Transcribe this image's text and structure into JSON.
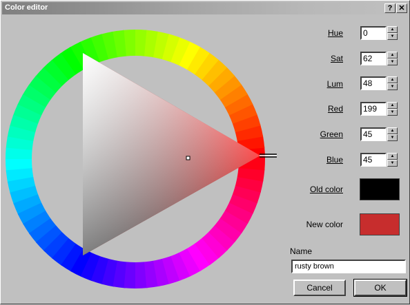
{
  "window": {
    "title": "Color editor",
    "help_glyph": "?",
    "close_glyph": "✕"
  },
  "fields": [
    {
      "key": "hue",
      "label": "Hue",
      "value": "0"
    },
    {
      "key": "sat",
      "label": "Sat",
      "value": "62"
    },
    {
      "key": "lum",
      "label": "Lum",
      "value": "48"
    },
    {
      "key": "red",
      "label": "Red",
      "value": "199"
    },
    {
      "key": "green",
      "label": "Green",
      "value": "45"
    },
    {
      "key": "blue",
      "label": "Blue",
      "value": "45"
    }
  ],
  "old_color": {
    "label": "Old color",
    "color": "#000000"
  },
  "new_color": {
    "label": "New color",
    "color": "#c72d2d"
  },
  "name": {
    "label": "Name",
    "value": "rusty brown"
  },
  "buttons": {
    "cancel": "Cancel",
    "ok": "OK"
  },
  "picker": {
    "hue": 0,
    "sat": 62,
    "lum": 48
  }
}
